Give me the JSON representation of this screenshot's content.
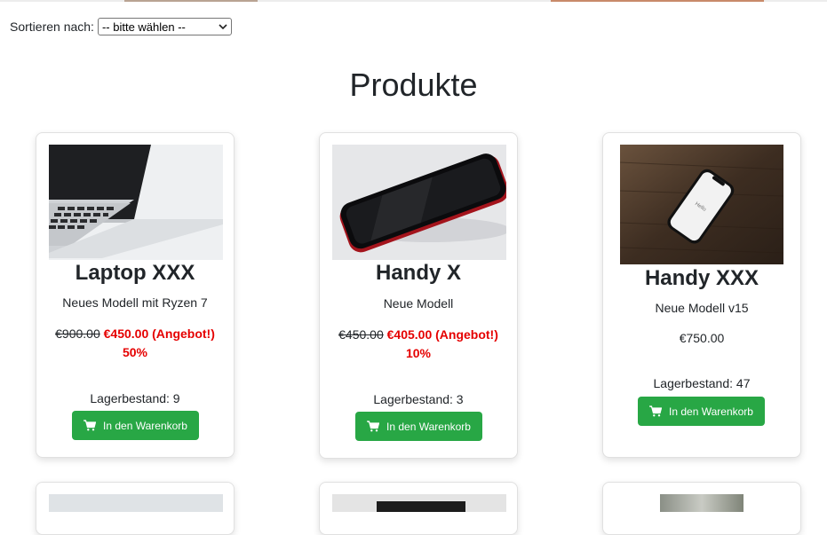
{
  "sort": {
    "label": "Sortieren nach:",
    "selected": "-- bitte wählen --"
  },
  "page": {
    "title": "Produkte"
  },
  "products": [
    {
      "name": "Laptop XXX",
      "description": "Neues Modell mit Ryzen 7",
      "old_price": "€900.00",
      "new_price": "€450.00 (Angebot!)",
      "discount": "50%",
      "stock": "Lagerbestand: 9",
      "button": "In den Warenkorb"
    },
    {
      "name": "Handy X",
      "description": "Neue Modell",
      "old_price": "€450.00",
      "new_price": "€405.00 (Angebot!)",
      "discount": "10%",
      "stock": "Lagerbestand: 3",
      "button": "In den Warenkorb"
    },
    {
      "name": "Handy XXX",
      "description": "Neue Modell v15",
      "price": "€750.00",
      "stock": "Lagerbestand: 47",
      "button": "In den Warenkorb",
      "screen_text": "Hello"
    }
  ],
  "colors": {
    "button": "#28a745",
    "offer": "#e50000",
    "text": "#212529"
  }
}
